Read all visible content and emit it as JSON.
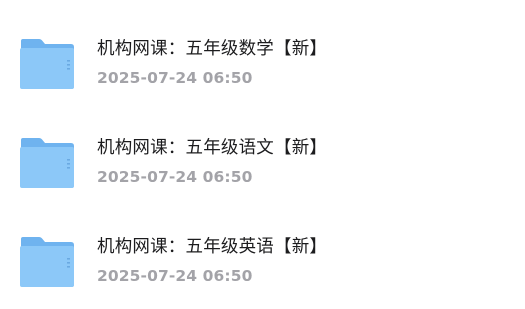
{
  "files": [
    {
      "icon": "folder-icon",
      "title": "机构网课：五年级数学【新】",
      "date": "2025-07-24 06:50"
    },
    {
      "icon": "folder-icon",
      "title": "机构网课：五年级语文【新】",
      "date": "2025-07-24 06:50"
    },
    {
      "icon": "folder-icon",
      "title": "机构网课：五年级英语【新】",
      "date": "2025-07-24 06:50"
    }
  ],
  "colors": {
    "folder_back": "#6fb3ef",
    "folder_front": "#8cc8f8",
    "title_text": "#1c1c1e",
    "date_text": "#a3a3a8"
  }
}
